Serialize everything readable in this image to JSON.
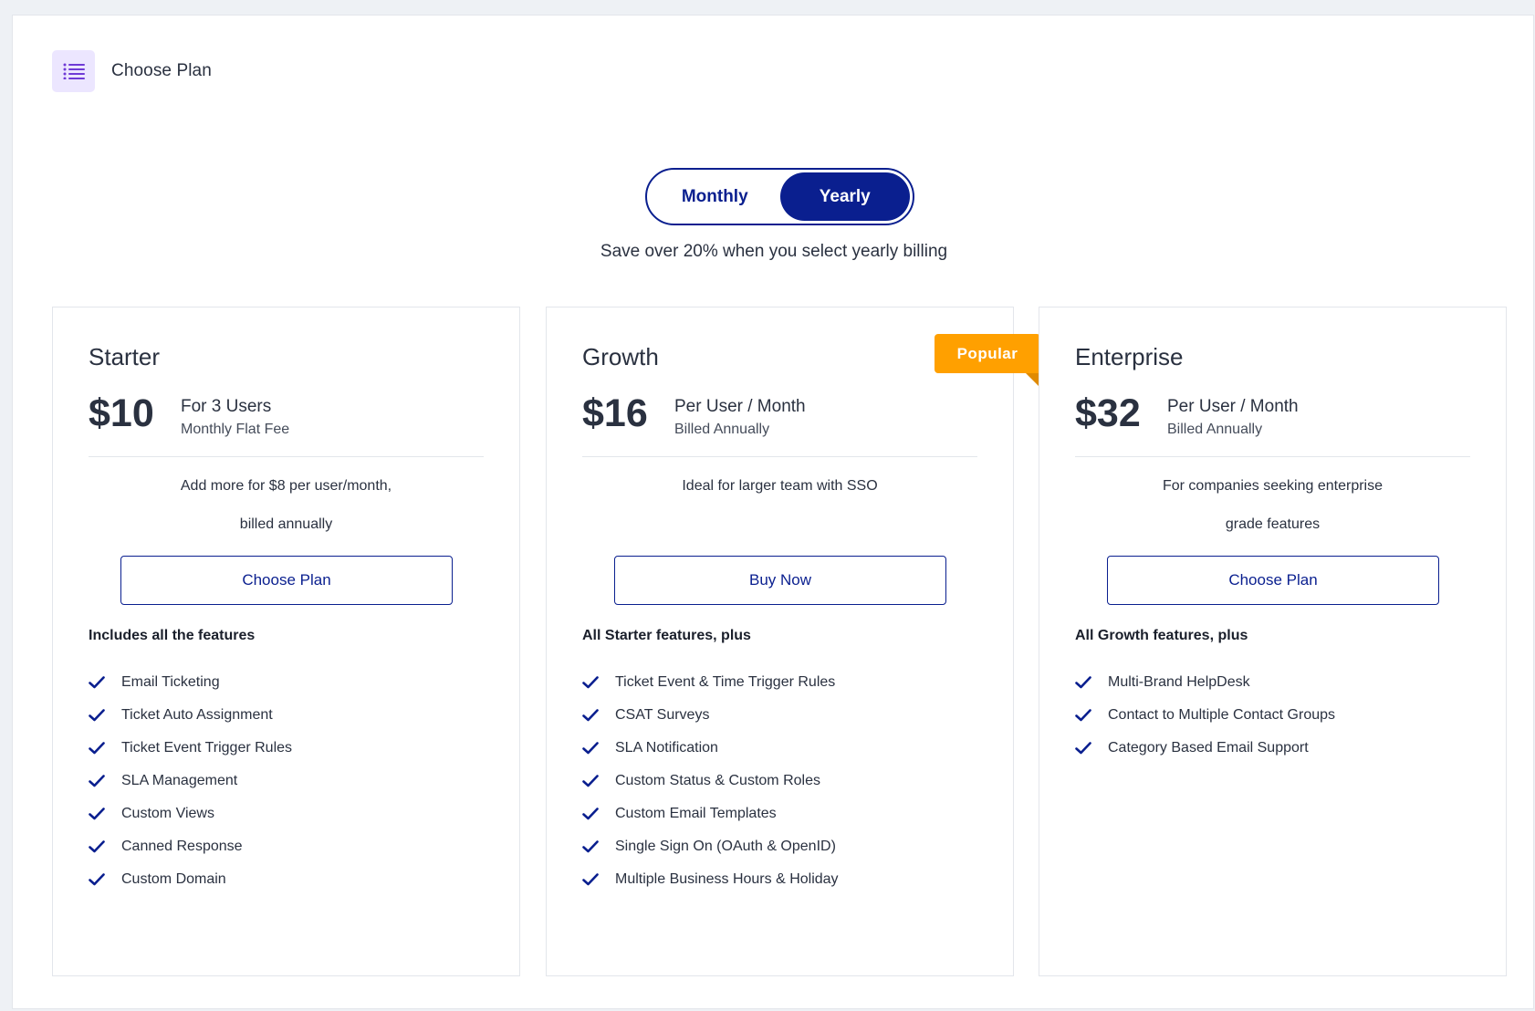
{
  "header": {
    "title": "Choose Plan"
  },
  "billing_toggle": {
    "monthly": "Monthly",
    "yearly": "Yearly",
    "selected": "Yearly"
  },
  "save_note": "Save over 20% when you select yearly billing",
  "plans": [
    {
      "name": "Starter",
      "price": "$10",
      "price_main": "For 3 Users",
      "price_sub": "Monthly Flat Fee",
      "desc_line1": "Add more for $8 per user/month,",
      "desc_line2": "billed annually",
      "cta": "Choose Plan",
      "features_heading": "Includes all the features",
      "features": [
        "Email Ticketing",
        "Ticket Auto Assignment",
        "Ticket Event Trigger Rules",
        "SLA Management",
        "Custom Views",
        "Canned Response",
        "Custom Domain"
      ]
    },
    {
      "name": "Growth",
      "badge": "Popular",
      "price": "$16",
      "price_main": "Per User / Month",
      "price_sub": "Billed Annually",
      "desc_line1": "Ideal for larger team with SSO",
      "desc_line2": "",
      "cta": "Buy Now",
      "features_heading": "All Starter features, plus",
      "features": [
        "Ticket Event & Time Trigger Rules",
        "CSAT Surveys",
        "SLA Notification",
        "Custom Status & Custom Roles",
        "Custom Email Templates",
        "Single Sign On (OAuth & OpenID)",
        "Multiple Business Hours & Holiday"
      ]
    },
    {
      "name": "Enterprise",
      "price": "$32",
      "price_main": "Per User / Month",
      "price_sub": "Billed Annually",
      "desc_line1": "For companies seeking enterprise",
      "desc_line2": "grade features",
      "cta": "Choose Plan",
      "features_heading": "All Growth features, plus",
      "features": [
        "Multi-Brand HelpDesk",
        "Contact to Multiple Contact Groups",
        "Category Based Email Support"
      ]
    }
  ],
  "colors": {
    "primary": "#0a1f8f",
    "badge": "#ffa000",
    "menu_bg": "#ece6ff",
    "menu_icon": "#6f3ad6"
  }
}
